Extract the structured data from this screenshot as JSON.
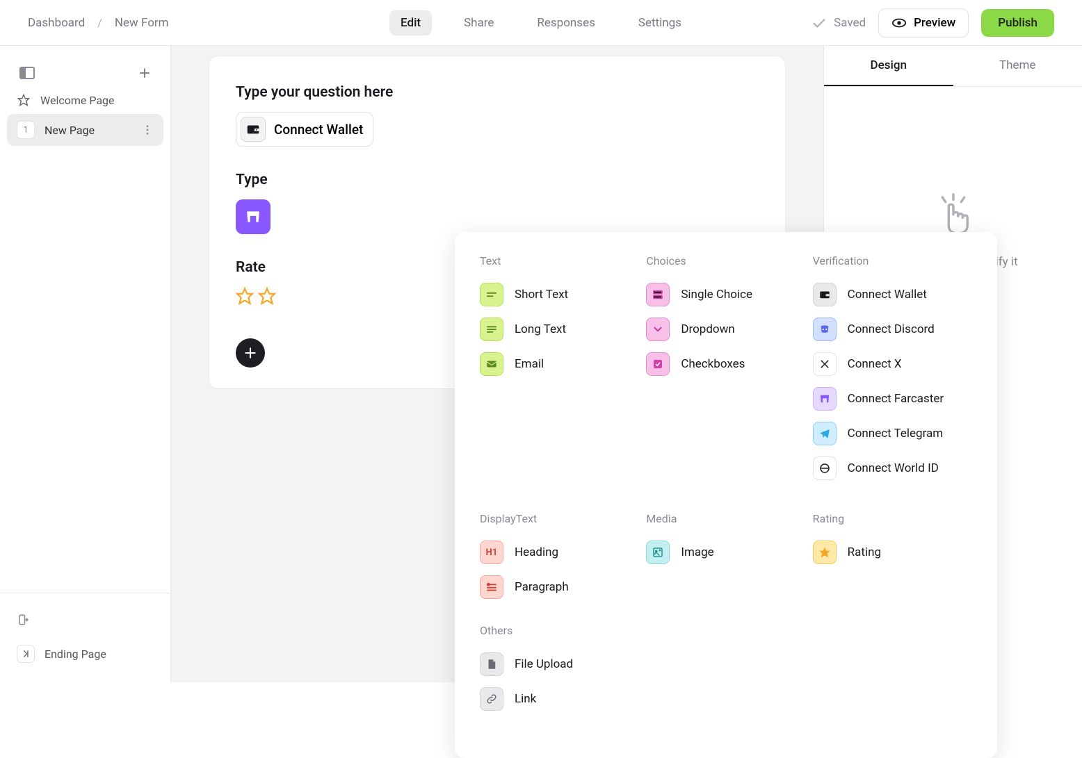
{
  "breadcrumb": {
    "dashboard": "Dashboard",
    "current": "New Form"
  },
  "header_tabs": {
    "edit": "Edit",
    "share": "Share",
    "responses": "Responses",
    "settings": "Settings"
  },
  "header_right": {
    "saved": "Saved",
    "preview": "Preview",
    "publish": "Publish"
  },
  "sidebar": {
    "welcome": "Welcome Page",
    "new_page_number": "1",
    "new_page": "New Page",
    "ending": "Ending Page"
  },
  "canvas": {
    "q1_title": "Type your question here",
    "connect_wallet": "Connect Wallet",
    "q2_title_partial": "Type",
    "rate_label_partial": "Rate"
  },
  "popup": {
    "text_header": "Text",
    "text_items": [
      "Short Text",
      "Long Text",
      "Email"
    ],
    "choices_header": "Choices",
    "choices_items": [
      "Single Choice",
      "Dropdown",
      "Checkboxes"
    ],
    "verification_header": "Verification",
    "verification_items": [
      "Connect Wallet",
      "Connect Discord",
      "Connect X",
      "Connect Farcaster",
      "Connect Telegram",
      "Connect World ID"
    ],
    "display_header": "DisplayText",
    "display_items": [
      "Heading",
      "Paragraph"
    ],
    "media_header": "Media",
    "media_items": [
      "Image"
    ],
    "rating_header": "Rating",
    "rating_items": [
      "Rating"
    ],
    "others_header": "Others",
    "others_items": [
      "File Upload",
      "Link"
    ]
  },
  "right": {
    "design": "Design",
    "theme": "Theme",
    "hint": "Select a field to modify it"
  }
}
